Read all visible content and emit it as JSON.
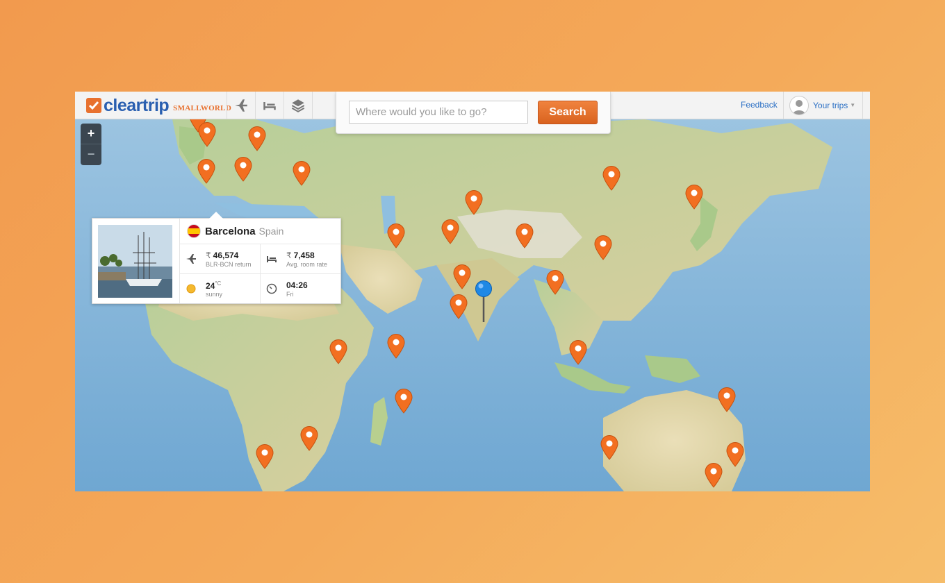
{
  "brand": {
    "name": "cleartrip",
    "product": "SMALLWORLD"
  },
  "nav": {
    "icons": [
      "flights-icon",
      "hotels-icon",
      "packages-icon"
    ]
  },
  "search": {
    "placeholder": "Where would you like to go?",
    "button_label": "Search"
  },
  "header": {
    "feedback_label": "Feedback",
    "trips_label": "Your trips"
  },
  "map_controls": {
    "zoom_in": "+",
    "zoom_out": "−"
  },
  "popup": {
    "city": "Barcelona",
    "country": "Spain",
    "flight": {
      "currency": "₹",
      "price": "46,574",
      "route": "BLR-BCN return"
    },
    "hotel": {
      "currency": "₹",
      "price": "7,458",
      "caption": "Avg. room rate"
    },
    "weather": {
      "temp": "24",
      "unit": "°C",
      "condition": "sunny"
    },
    "time": {
      "value": "04:26",
      "day": "Fri"
    }
  },
  "colors": {
    "accent": "#e8712f",
    "brand_blue": "#2a5fb0",
    "link": "#2a6fc4",
    "pin": "#f26f21",
    "current_location": "#1e88e5"
  }
}
